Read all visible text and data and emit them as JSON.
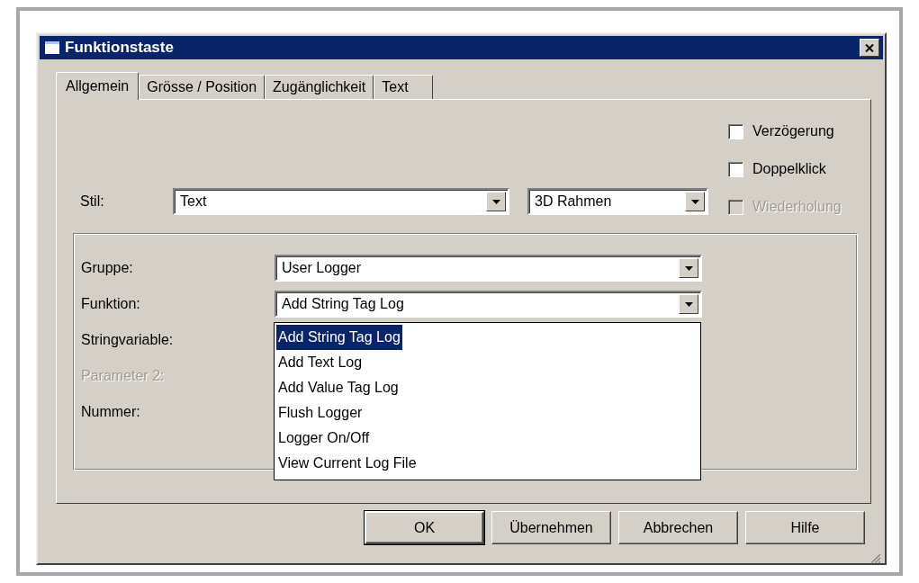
{
  "window": {
    "title": "Funktionstaste"
  },
  "tabs": [
    {
      "label": "Allgemein",
      "selected": true
    },
    {
      "label": "Grösse / Position",
      "selected": false
    },
    {
      "label": "Zugänglichkeit",
      "selected": false
    },
    {
      "label": "Text",
      "selected": false
    }
  ],
  "options": [
    {
      "label": "Verzögerung",
      "checked": false,
      "disabled": false
    },
    {
      "label": "Doppelklick",
      "checked": false,
      "disabled": false
    },
    {
      "label": "Wiederholung",
      "checked": false,
      "disabled": true
    }
  ],
  "style": {
    "label": "Stil:",
    "value": "Text",
    "frame": "3D Rahmen"
  },
  "fields": [
    {
      "label": "Gruppe:",
      "kind": "combo",
      "value": "User Logger",
      "disabled": false
    },
    {
      "label": "Funktion:",
      "kind": "combo",
      "value": "Add String Tag Log",
      "disabled": false
    },
    {
      "label": "Stringvariable:",
      "kind": "label",
      "disabled": false
    },
    {
      "label": "Parameter 2:",
      "kind": "label",
      "disabled": true
    },
    {
      "label": "Nummer:",
      "kind": "label",
      "disabled": false
    }
  ],
  "dropdown": {
    "items": [
      {
        "label": "Add String Tag Log",
        "selected": true
      },
      {
        "label": "Add Text Log",
        "selected": false
      },
      {
        "label": "Add Value Tag Log",
        "selected": false
      },
      {
        "label": "Flush Logger",
        "selected": false
      },
      {
        "label": "Logger On/Off",
        "selected": false
      },
      {
        "label": "View Current Log File",
        "selected": false
      }
    ]
  },
  "buttons": [
    {
      "label": "OK",
      "default": true
    },
    {
      "label": "Übernehmen",
      "default": false
    },
    {
      "label": "Abbrechen",
      "default": false
    },
    {
      "label": "Hilfe",
      "default": false
    }
  ]
}
